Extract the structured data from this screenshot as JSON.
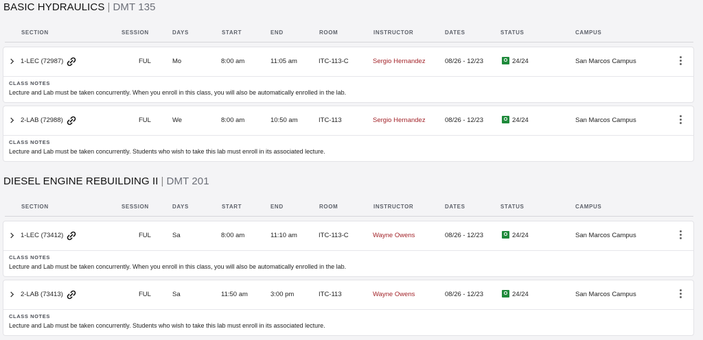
{
  "columns": {
    "section": "SECTION",
    "session": "SESSION",
    "days": "DAYS",
    "start": "START",
    "end": "END",
    "room": "ROOM",
    "instructor": "INSTRUCTOR",
    "dates": "DATES",
    "status": "STATUS",
    "campus": "CAMPUS"
  },
  "notes_label": "CLASS NOTES",
  "status_badge": "O",
  "courses": [
    {
      "title": "BASIC HYDRAULICS",
      "separator": "|",
      "code": "DMT 135",
      "sections": [
        {
          "section": "1-LEC (72987)",
          "session": "FUL",
          "days": "Mo",
          "start": "8:00 am",
          "end": "11:05 am",
          "room": "ITC-113-C",
          "instructor": "Sergio Hernandez",
          "dates": "08/26 - 12/23",
          "status": "24/24",
          "campus": "San Marcos Campus",
          "note": "Lecture and Lab must be taken concurrently. When you enroll in this class, you will also be automatically enrolled in the lab."
        },
        {
          "section": "2-LAB (72988)",
          "session": "FUL",
          "days": "We",
          "start": "8:00 am",
          "end": "10:50 am",
          "room": "ITC-113",
          "instructor": "Sergio Hernandez",
          "dates": "08/26 - 12/23",
          "status": "24/24",
          "campus": "San Marcos Campus",
          "note": "Lecture and Lab must be taken concurrently. Students who wish to take this lab must enroll in its associated lecture."
        }
      ]
    },
    {
      "title": "DIESEL ENGINE REBUILDING II",
      "separator": "|",
      "code": "DMT 201",
      "sections": [
        {
          "section": "1-LEC (73412)",
          "session": "FUL",
          "days": "Sa",
          "start": "8:00 am",
          "end": "11:10 am",
          "room": "ITC-113-C",
          "instructor": "Wayne Owens",
          "dates": "08/26 - 12/23",
          "status": "24/24",
          "campus": "San Marcos Campus",
          "note": "Lecture and Lab must be taken concurrently. When you enroll in this class, you will also be automatically enrolled in the lab."
        },
        {
          "section": "2-LAB (73413)",
          "session": "FUL",
          "days": "Sa",
          "start": "11:50 am",
          "end": "3:00 pm",
          "room": "ITC-113",
          "instructor": "Wayne Owens",
          "dates": "08/26 - 12/23",
          "status": "24/24",
          "campus": "San Marcos Campus",
          "note": "Lecture and Lab must be taken concurrently. Students who wish to take this lab must enroll in its associated lecture."
        }
      ]
    }
  ]
}
